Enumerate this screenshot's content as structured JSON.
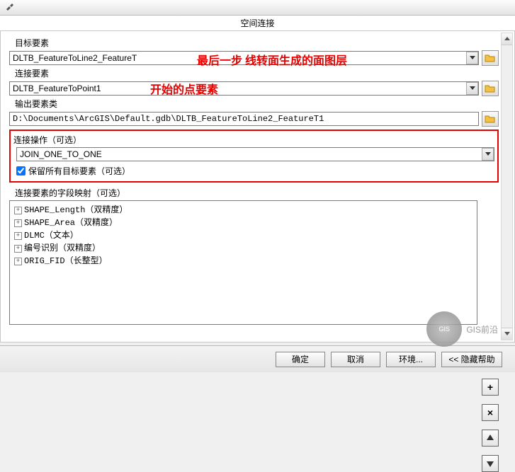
{
  "window_title": "空间连接",
  "labels": {
    "target": "目标要素",
    "join": "连接要素",
    "output_class": "输出要素类",
    "join_op": "连接操作（可选）",
    "keep_all": "保留所有目标要素（可选）",
    "field_map": "连接要素的字段映射（可选）"
  },
  "values": {
    "target": "DLTB_FeatureToLine2_FeatureT",
    "join": "DLTB_FeatureToPoint1",
    "output": "D:\\Documents\\ArcGIS\\Default.gdb\\DLTB_FeatureToLine2_FeatureT1",
    "join_op": "JOIN_ONE_TO_ONE",
    "keep_all_checked": true
  },
  "tree": [
    "SHAPE_Length（双精度）",
    "SHAPE_Area（双精度）",
    "DLMC（文本）",
    "编号识别（双精度）",
    "ORIG_FID（长整型）"
  ],
  "annotations": {
    "a1": "最后一步  线转面生成的面图层",
    "a2": "开始的点要素"
  },
  "buttons": {
    "ok": "确定",
    "cancel": "取消",
    "env": "环境...",
    "help": "<< 隐藏帮助"
  },
  "watermark": "GIS前沿"
}
